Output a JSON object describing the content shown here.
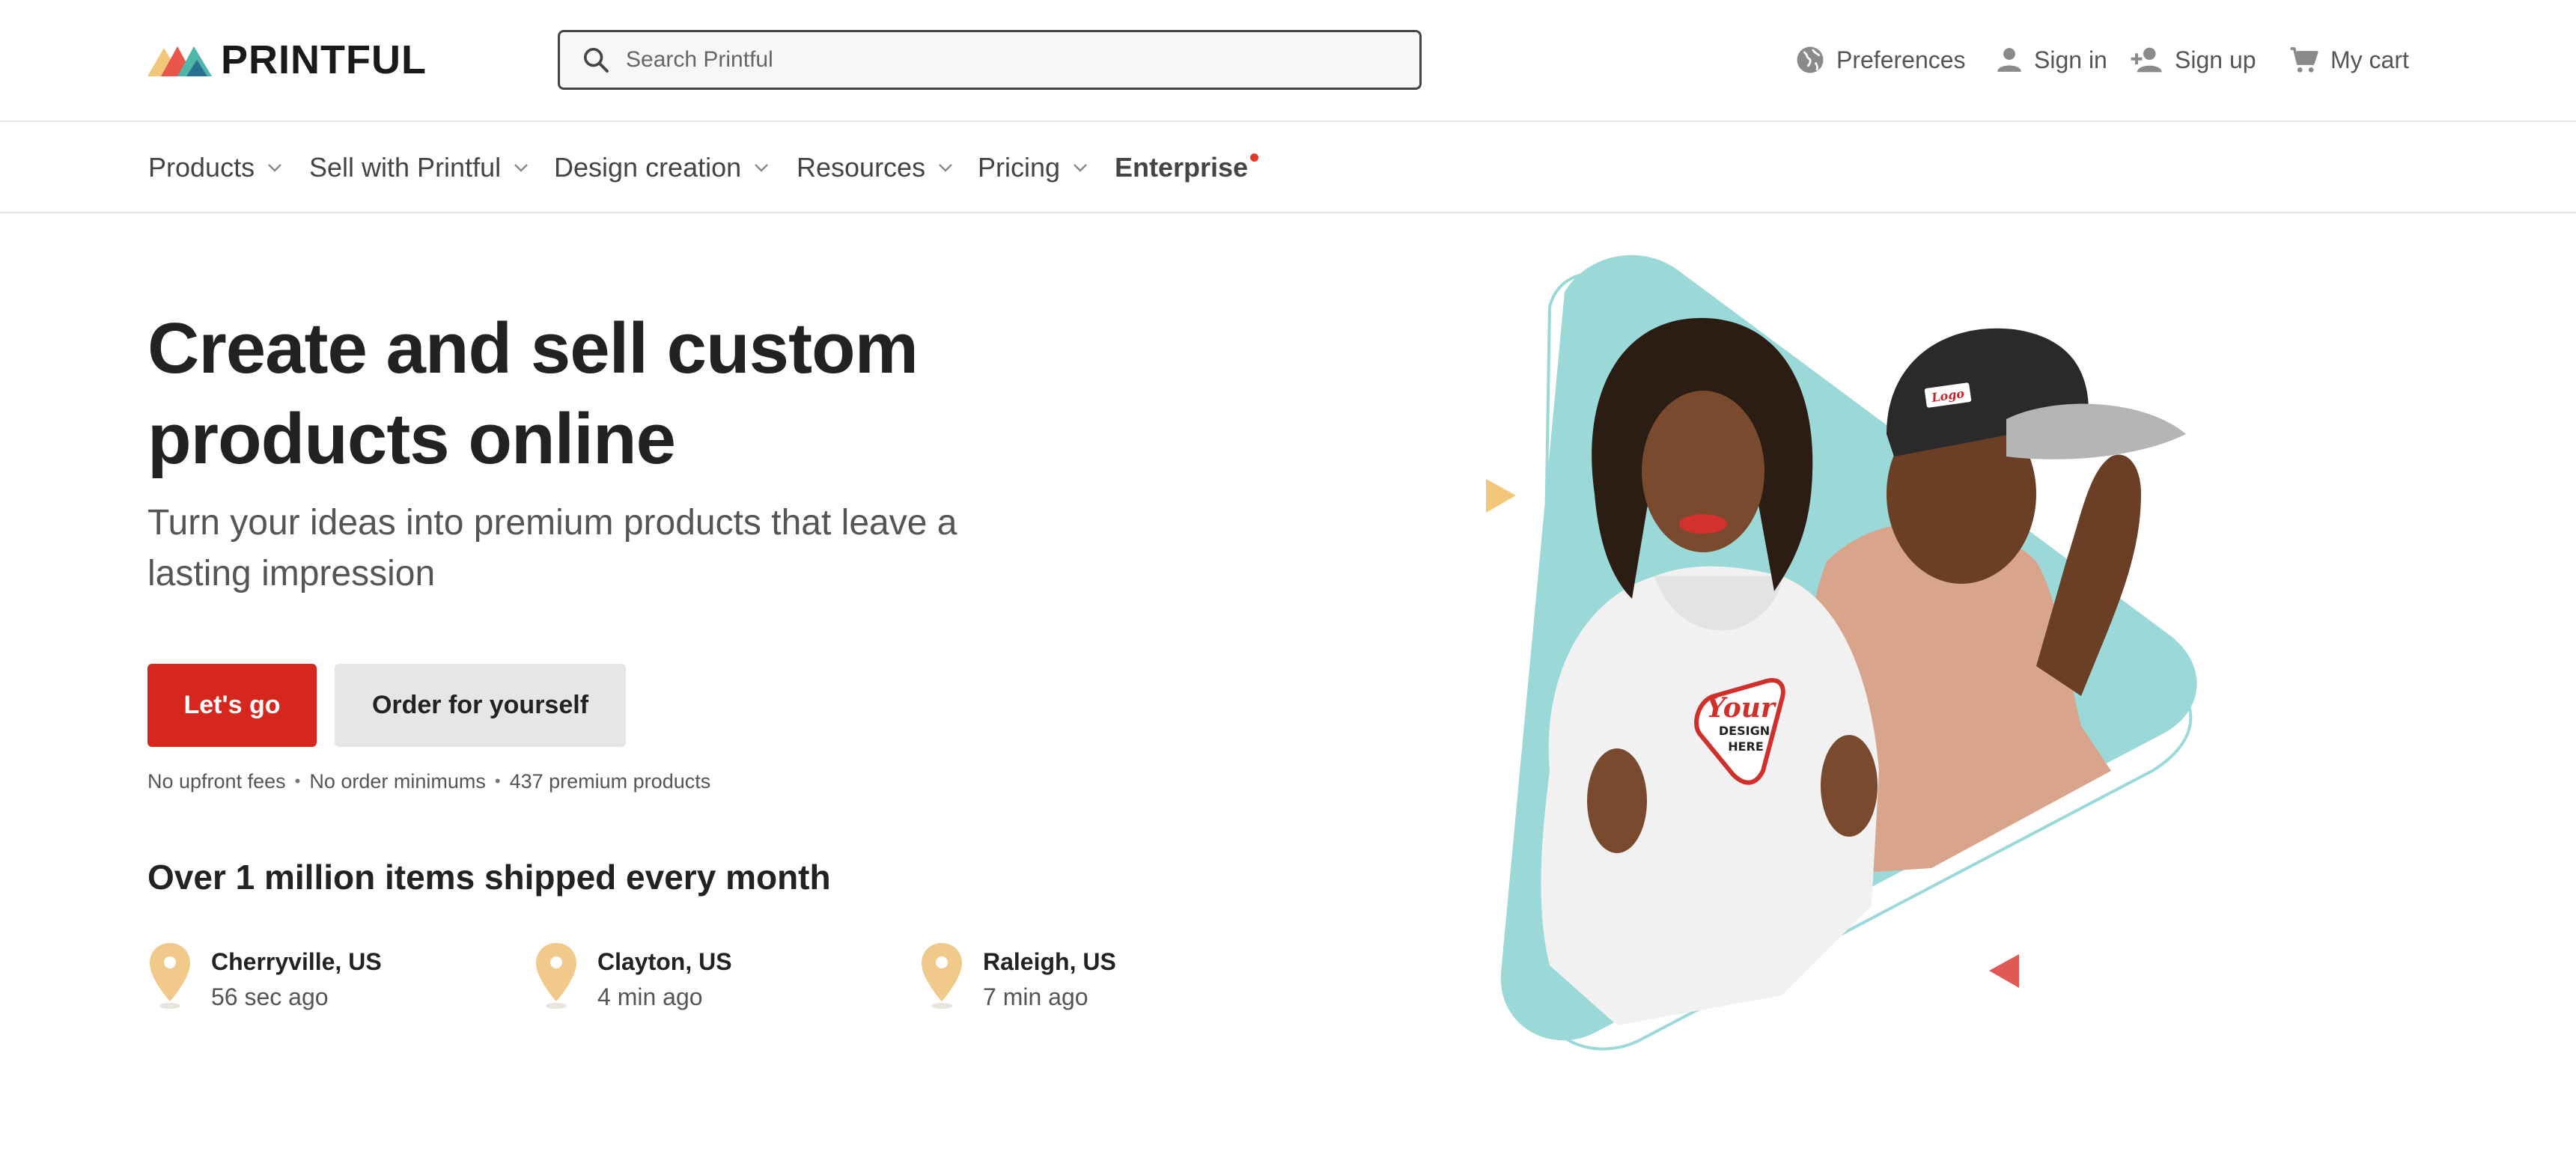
{
  "brand": {
    "name": "PRINTFUL"
  },
  "search": {
    "placeholder": "Search Printful"
  },
  "header_actions": {
    "preferences": "Preferences",
    "sign_in": "Sign in",
    "sign_up": "Sign up",
    "cart": "My cart"
  },
  "nav": {
    "items": [
      {
        "label": "Products",
        "dropdown": true
      },
      {
        "label": "Sell with Printful",
        "dropdown": true
      },
      {
        "label": "Design creation",
        "dropdown": true
      },
      {
        "label": "Resources",
        "dropdown": true
      },
      {
        "label": "Pricing",
        "dropdown": true
      },
      {
        "label": "Enterprise",
        "dropdown": false,
        "badge_dot": true
      }
    ]
  },
  "hero": {
    "title": "Create and sell custom products online",
    "subtitle": "Turn your ideas into premium products that leave a lasting impression",
    "primary_button": "Let's go",
    "secondary_button": "Order for yourself",
    "perks": [
      "No upfront fees",
      "No order minimums",
      "437 premium products"
    ]
  },
  "shipping": {
    "heading": "Over 1 million items shipped every month",
    "recent": [
      {
        "city": "Cherryville, US",
        "time": "56 sec ago"
      },
      {
        "city": "Clayton, US",
        "time": "4 min ago"
      },
      {
        "city": "Raleigh, US",
        "time": "7 min ago"
      }
    ]
  },
  "hero_image": {
    "hoodie_print": {
      "line1": "Your",
      "line2": "DESIGN",
      "line3": "HERE"
    },
    "cap_print": "Logo"
  },
  "colors": {
    "accent_red": "#d6271f",
    "teal": "#9ad9d8",
    "pin_gold": "#f0c98b",
    "button_grey": "#e6e6e6"
  },
  "icons": [
    "logo-mountains-icon",
    "search-icon",
    "globe-icon",
    "user-icon",
    "user-add-icon",
    "cart-icon",
    "chevron-down-icon",
    "location-pin-icon"
  ]
}
